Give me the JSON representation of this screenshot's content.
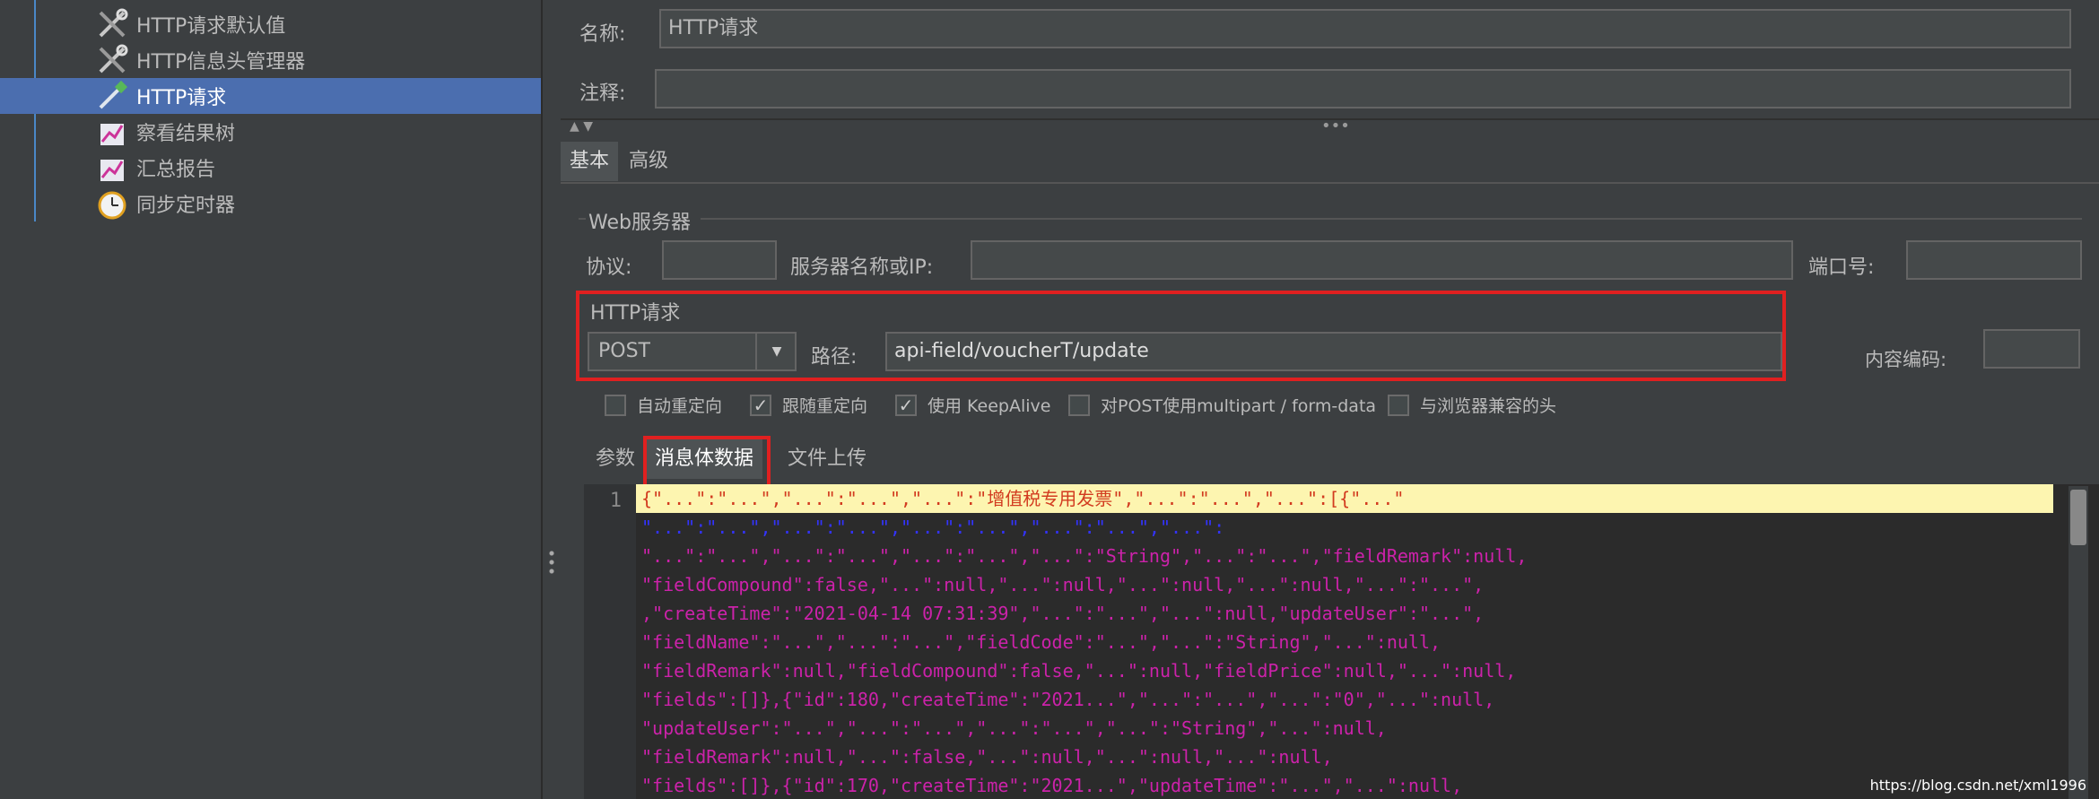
{
  "tree": {
    "items": [
      {
        "label": "HTTP请求默认值",
        "icon": "wrench-icon",
        "selected": false
      },
      {
        "label": "HTTP信息头管理器",
        "icon": "wrench-icon",
        "selected": false
      },
      {
        "label": "HTTP请求",
        "icon": "pipette-icon",
        "selected": true
      },
      {
        "label": "察看结果树",
        "icon": "chart-icon",
        "selected": false
      },
      {
        "label": "汇总报告",
        "icon": "chart-icon",
        "selected": false
      },
      {
        "label": "同步定时器",
        "icon": "clock-icon",
        "selected": false
      }
    ]
  },
  "form": {
    "name_label": "名称:",
    "name_value": "HTTP请求",
    "comment_label": "注释:",
    "comment_value": "",
    "tabs": [
      "基本",
      "高级"
    ],
    "web_server": {
      "title": "Web服务器",
      "protocol_label": "协议:",
      "protocol_value": "",
      "server_label": "服务器名称或IP:",
      "server_value": "",
      "port_label": "端口号:",
      "port_value": ""
    },
    "http_request": {
      "title": "HTTP请求",
      "method": "POST",
      "path_label": "路径:",
      "path_value": "api-field/voucherT/update",
      "encoding_label": "内容编码:",
      "encoding_value": ""
    },
    "options": [
      {
        "label": "自动重定向",
        "checked": false
      },
      {
        "label": "跟随重定向",
        "checked": true
      },
      {
        "label": "使用 KeepAlive",
        "checked": true
      },
      {
        "label": "对POST使用multipart / form-data",
        "checked": false
      },
      {
        "label": "与浏览器兼容的头",
        "checked": false
      }
    ],
    "subtabs": [
      "参数",
      "消息体数据",
      "文件上传"
    ]
  },
  "editor": {
    "line_number": "1",
    "lines": [
      "{\"...\":\"...\",\"...\":\"...\",\"...\":\"增值税专用发票\",\"...\":\"...\",\"...\":[{\"...\"",
      "\"...\":\"...\",\"...\":\"...\",\"...\":\"...\",\"...\":\"...\",\"...\":",
      "\"...\":\"...\",\"...\":\"...\",\"...\":\"...\",\"...\":\"String\",\"...\":\"...\",\"fieldRemark\":null,",
      "\"fieldCompound\":false,\"...\":null,\"...\":null,\"...\":null,\"...\":null,\"...\":\"...\",",
      ",\"createTime\":\"2021-04-14 07:31:39\",\"...\":\"...\",\"...\":null,\"updateUser\":\"...\",",
      "\"fieldName\":\"...\",\"...\":\"...\",\"fieldCode\":\"...\",\"...\":\"String\",\"...\":null,",
      "\"fieldRemark\":null,\"fieldCompound\":false,\"...\":null,\"fieldPrice\":null,\"...\":null,",
      "\"fields\":[]},{\"id\":180,\"createTime\":\"2021...\",\"...\":\"...\",\"...\":\"0\",\"...\":null,",
      "\"updateUser\":\"...\",\"...\":\"...\",\"...\":\"...\",\"...\":\"String\",\"...\":null,",
      "\"fieldRemark\":null,\"...\":false,\"...\":null,\"...\":null,\"...\":null,",
      "\"fields\":[]},{\"id\":170,\"createTime\":\"2021...\",\"updateTime\":\"...\",\"...\":null,"
    ]
  },
  "watermark": "https://blog.csdn.net/xml1996",
  "colors": {
    "selection": "#4b6eaf",
    "highlight_box": "#e02020",
    "first_line_bg": "#fdf5b0",
    "string_color": "#cc22aa",
    "keyword_color": "#3333ff"
  }
}
